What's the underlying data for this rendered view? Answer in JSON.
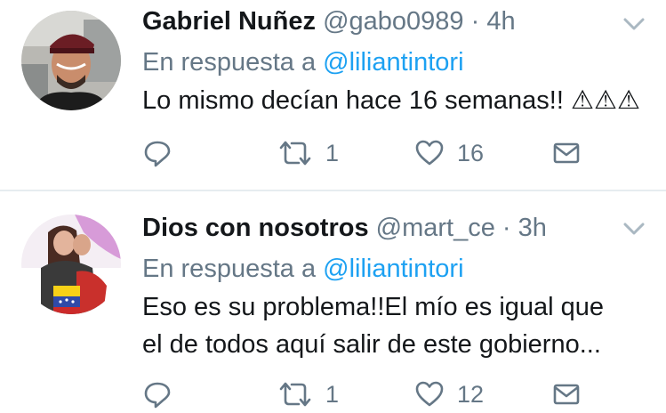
{
  "tweets": [
    {
      "name": "Gabriel Nuñez",
      "handle": "@gabo0989",
      "separator": "·",
      "time": "4h",
      "reply_prefix": "En respuesta a",
      "reply_to": "@liliantintori",
      "text_lines": [
        "Lo mismo decían hace 16 semanas!! ⚠⚠⚠"
      ],
      "retweets": "1",
      "likes": "16"
    },
    {
      "name": "Dios con nosotros",
      "handle": "@mart_ce",
      "separator": "·",
      "time": "3h",
      "reply_prefix": "En respuesta a",
      "reply_to": "@liliantintori",
      "text_lines": [
        "Eso es su problema!!El mío es igual que",
        "el de todos aquí salir de este gobierno..."
      ],
      "retweets": "1",
      "likes": "12"
    }
  ],
  "colors": {
    "text": "#14171a",
    "secondary": "#657786",
    "link": "#1da1f2",
    "divider": "#e6ecf0"
  },
  "icons": {
    "reply": "reply-icon",
    "retweet": "retweet-icon",
    "like": "heart-icon",
    "dm": "envelope-icon",
    "menu": "chevron-down-icon"
  }
}
